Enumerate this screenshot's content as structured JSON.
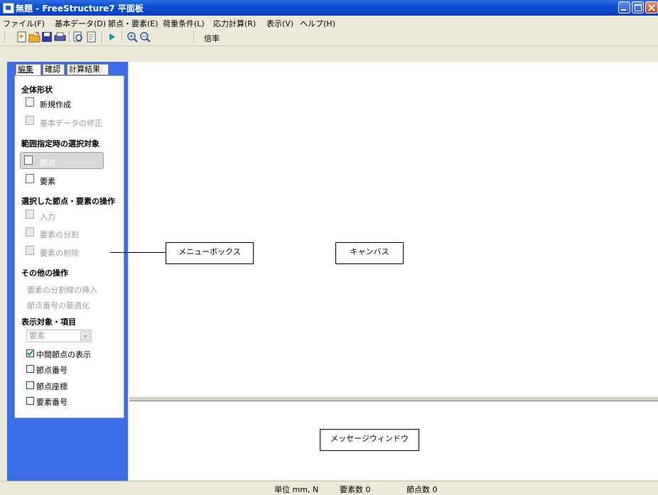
{
  "window": {
    "title": "無題 - FreeStructure7 平面板"
  },
  "menu": [
    "ファイル(F)",
    "基本データ(D)",
    "節点・要素(E)",
    "荷重条件(L)",
    "応力計算(R)",
    "表示(V)",
    "ヘルプ(H)"
  ],
  "toolbar": {
    "zoom_label": "倍率",
    "icons": [
      "new-file-icon",
      "open-folder-icon",
      "save-icon",
      "print-icon",
      "print-preview-icon",
      "page-setup-icon",
      "run-icon",
      "zoom-in-icon",
      "zoom-out-icon"
    ]
  },
  "tabs": [
    "編集",
    "確認",
    "計算結果"
  ],
  "panel": {
    "sections": [
      "全体形状",
      "範囲指定時の選択対象",
      "選択した節点・要素の操作",
      "その他の操作",
      "表示対象・項目"
    ],
    "overall": [
      "新規作成",
      "基本データの修正"
    ],
    "selection_target": [
      "節点",
      "要素"
    ],
    "selected_ops": [
      "入力",
      "要素の分割",
      "要素の削除"
    ],
    "other_ops": [
      "要素の分割線の挿入",
      "節点番号の最適化"
    ],
    "display_select": "要素",
    "checkboxes": [
      {
        "label": "中間節点の表示",
        "checked": true
      },
      {
        "label": "節点番号",
        "checked": false
      },
      {
        "label": "節点座標",
        "checked": false
      },
      {
        "label": "要素番号",
        "checked": false
      }
    ]
  },
  "annotations": {
    "menubox": "メニューボックス",
    "canvas": "キャンバス",
    "message": "メッセージウィンドウ"
  },
  "status": {
    "unit": "単位 mm, N",
    "elements": "要素数 0",
    "nodes": "節点数 0"
  }
}
